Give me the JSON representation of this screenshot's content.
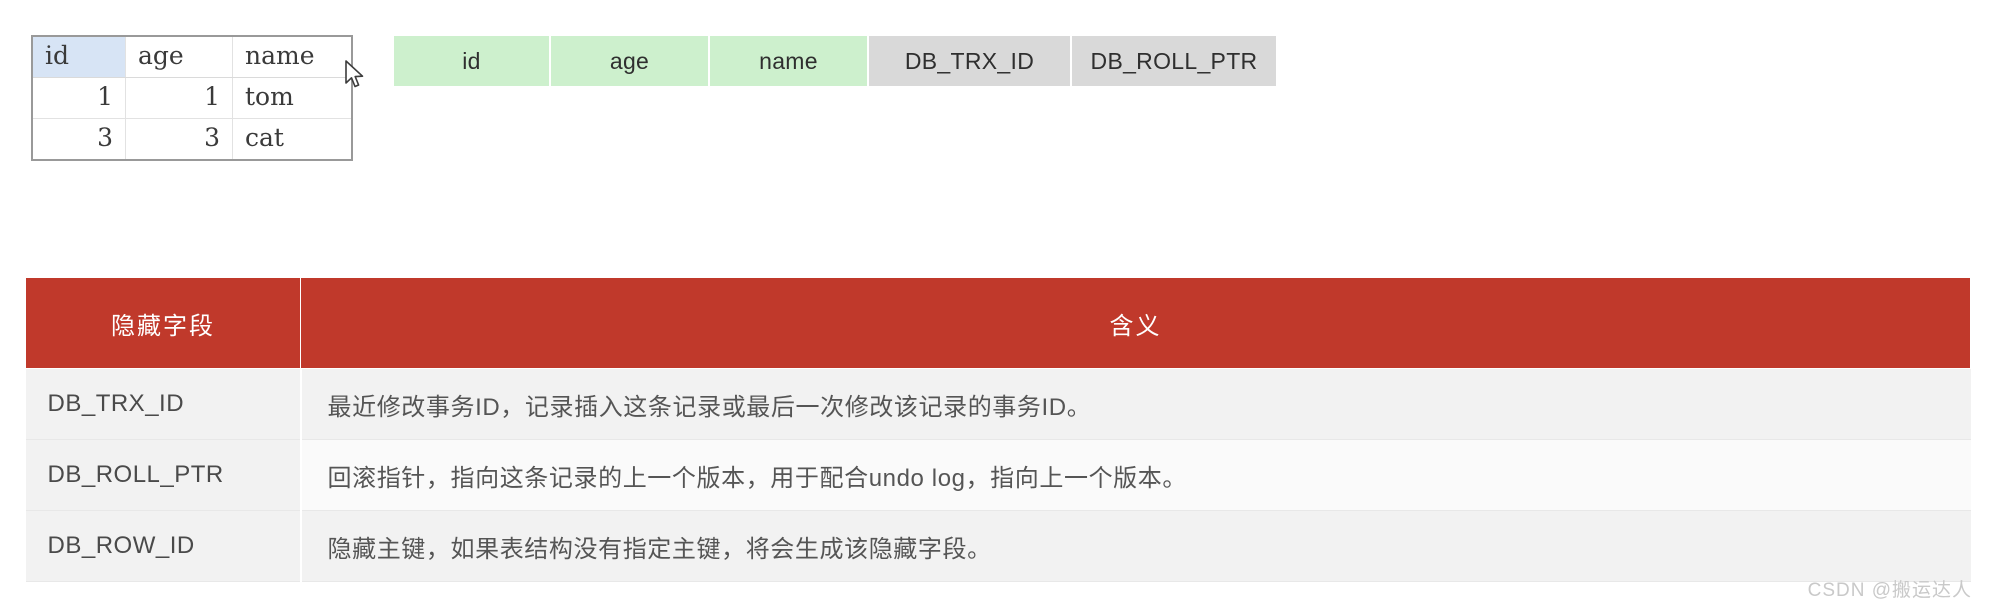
{
  "record_table": {
    "name": "user-record-table",
    "columns": [
      "id",
      "age",
      "name"
    ],
    "highlighted_column": "id",
    "rows": [
      {
        "id": "1",
        "age": "1",
        "name": "tom"
      },
      {
        "id": "3",
        "age": "3",
        "name": "cat"
      }
    ]
  },
  "cursor": {
    "icon": "mouse-pointer-icon"
  },
  "field_chips": {
    "visible_fields": [
      {
        "label": "id",
        "style": "green"
      },
      {
        "label": "age",
        "style": "green"
      },
      {
        "label": "name",
        "style": "green"
      }
    ],
    "hidden_fields": [
      {
        "label": "DB_TRX_ID",
        "style": "gray"
      },
      {
        "label": "DB_ROLL_PTR",
        "style": "gray"
      }
    ]
  },
  "definition_table": {
    "headers": [
      "隐藏字段",
      "含义"
    ],
    "header_bg": "#c0392b",
    "rows": [
      {
        "field": "DB_TRX_ID",
        "meaning": "最近修改事务ID，记录插入这条记录或最后一次修改该记录的事务ID。"
      },
      {
        "field": "DB_ROLL_PTR",
        "meaning": "回滚指针，指向这条记录的上一个版本，用于配合undo log，指向上一个版本。"
      },
      {
        "field": "DB_ROW_ID",
        "meaning": "隐藏主键，如果表结构没有指定主键，将会生成该隐藏字段。"
      }
    ]
  },
  "watermark": {
    "text": "CSDN @搬运达人"
  }
}
